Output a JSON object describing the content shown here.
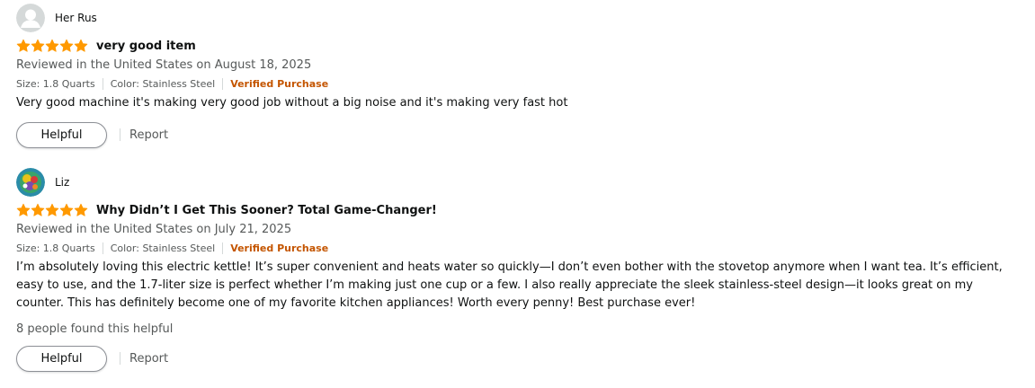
{
  "colors": {
    "star": "#ff9900",
    "verified": "#c45500",
    "muted": "#565959"
  },
  "reviews": [
    {
      "author": "Her Rus",
      "avatar": "default-user-avatar-icon",
      "rating": 5,
      "title": "very good item",
      "date": "Reviewed in the United States on August 18, 2025",
      "size": "Size: 1.8 Quarts",
      "color": "Color: Stainless Steel",
      "verified": "Verified Purchase",
      "body": "Very good machine it's making very good job without a big noise and it's making very fast hot",
      "helpful_count": "",
      "helpful_label": "Helpful",
      "report_label": "Report"
    },
    {
      "author": "Liz",
      "avatar": "colorful-photo-avatar-icon",
      "rating": 5,
      "title": "Why Didn’t I Get This Sooner? Total Game-Changer!",
      "date": "Reviewed in the United States on July 21, 2025",
      "size": "Size: 1.8 Quarts",
      "color": "Color: Stainless Steel",
      "verified": "Verified Purchase",
      "body": "I’m absolutely loving this electric kettle! It’s super convenient and heats water so quickly—I don’t even bother with the stovetop anymore when I want tea. It’s efficient, easy to use, and the 1.7-liter size is perfect whether I’m making just one cup or a few. I also really appreciate the sleek stainless-steel design—it looks great on my counter. This has definitely become one of my favorite kitchen appliances! Worth every penny! Best purchase ever!",
      "helpful_count": "8 people found this helpful",
      "helpful_label": "Helpful",
      "report_label": "Report"
    }
  ]
}
